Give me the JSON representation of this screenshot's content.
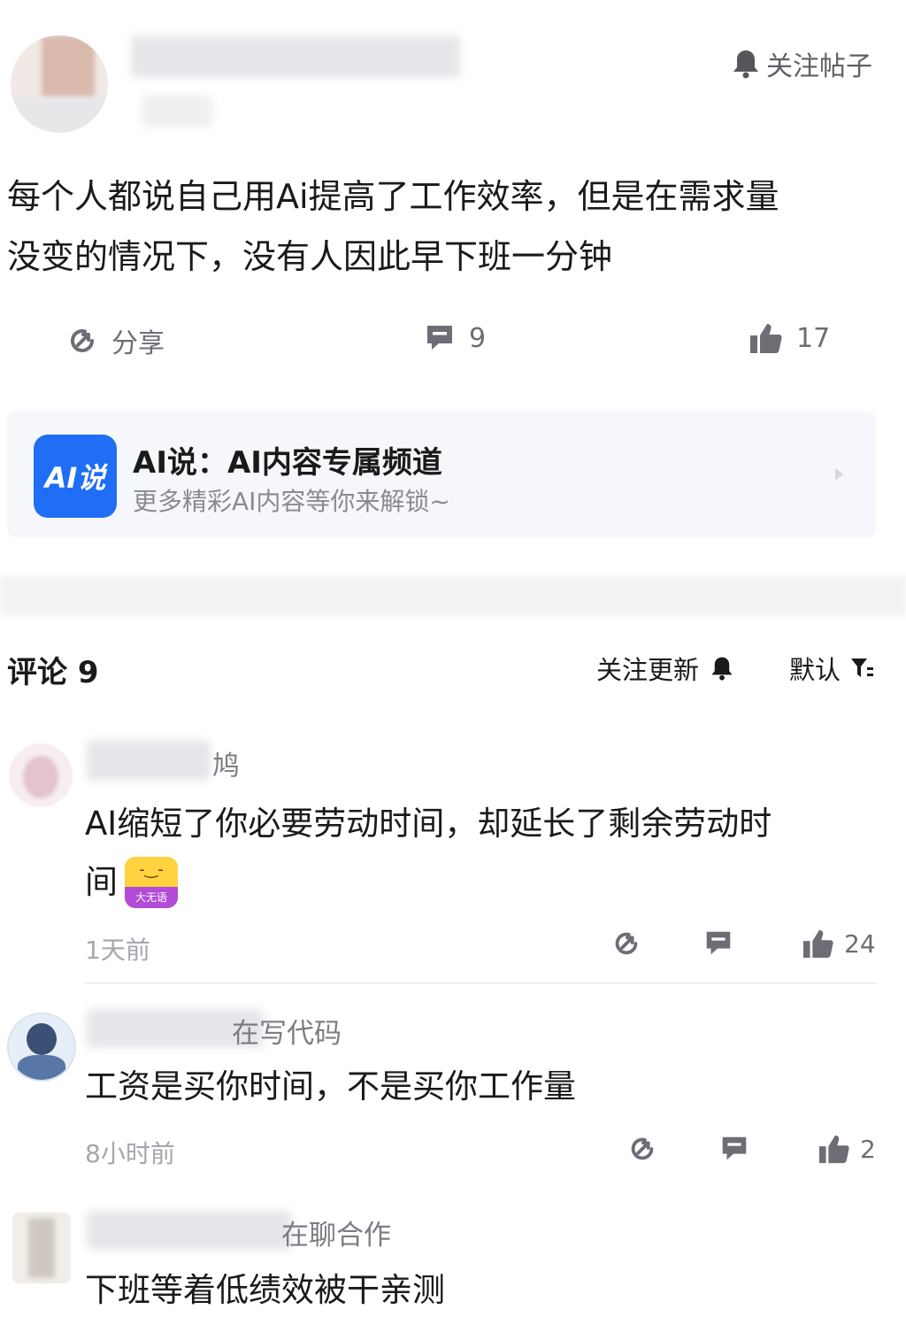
{
  "post": {
    "follow_label": "关注帖子",
    "body_line1": "每个人都说自己用Ai提高了工作效率，但是在需求量",
    "body_line2": "没变的情况下，没有人因此早下班一分钟",
    "share_label": "分享",
    "comment_count": "9",
    "like_count": "17"
  },
  "channel": {
    "logo_text": "AI说",
    "title": "AI说：AI内容专属频道",
    "subtitle": "更多精彩AI内容等你来解锁~"
  },
  "comments_header": {
    "title": "评论 9",
    "follow_updates": "关注更新",
    "sort_label": "默认"
  },
  "comments": [
    {
      "name_visible": "鸠",
      "text_line1": "AI缩短了你必要劳动时间，却延长了剩余劳动时",
      "text_line2": "间",
      "sticker_label": "大无语",
      "time": "1天前",
      "likes": "24"
    },
    {
      "name_visible": "在写代码",
      "text_line1": "工资是买你时间，不是买你工作量",
      "time": "8小时前",
      "likes": "2"
    },
    {
      "name_visible": "在聊合作",
      "text_line1": "下班等着低绩效被干亲测"
    }
  ],
  "colors": {
    "accent_blue": "#1f6ef5",
    "text_main": "#1a1a1a",
    "text_muted": "#9a9aa2",
    "icon_gray": "#6d6d75"
  }
}
